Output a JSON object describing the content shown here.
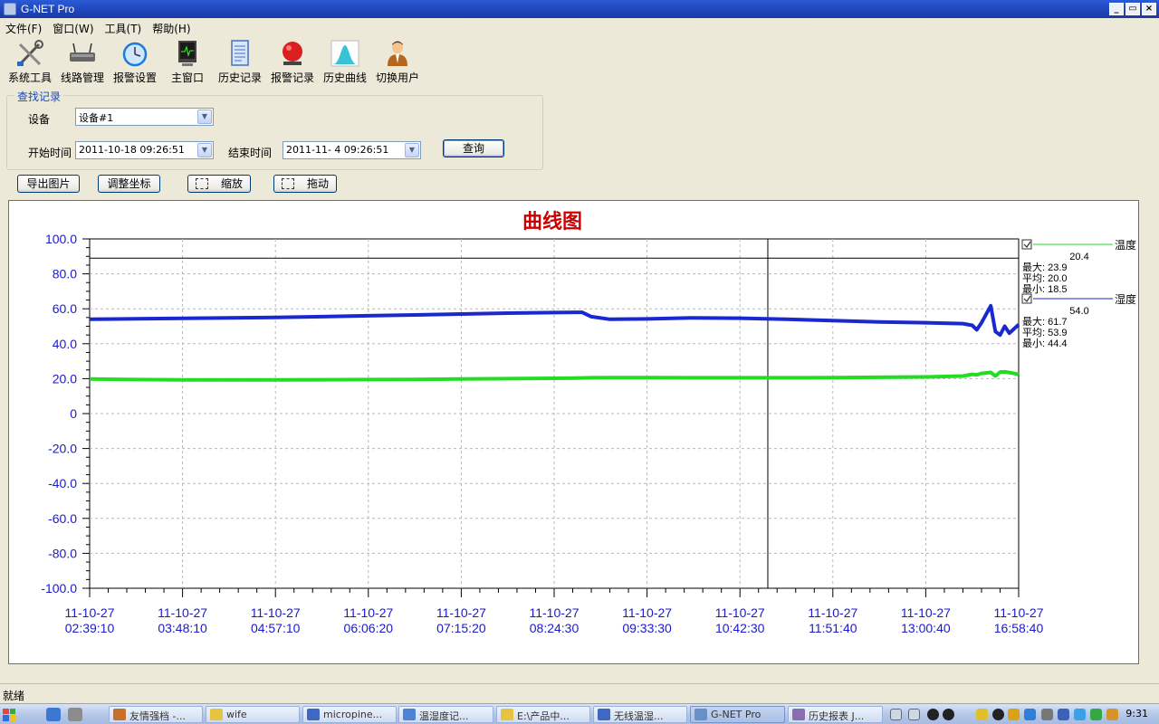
{
  "window": {
    "title": "G-NET Pro",
    "buttons": [
      "_",
      "▭",
      "×"
    ]
  },
  "menu": [
    "文件(F)",
    "窗口(W)",
    "工具(T)",
    "帮助(H)"
  ],
  "toolbar": [
    {
      "label": "系统工具",
      "icon": "tools-icon"
    },
    {
      "label": "线路管理",
      "icon": "router-icon"
    },
    {
      "label": "报警设置",
      "icon": "alarm-clock-icon"
    },
    {
      "label": "主窗口",
      "icon": "monitor-icon"
    },
    {
      "label": "历史记录",
      "icon": "document-icon"
    },
    {
      "label": "报警记录",
      "icon": "alarm-bell-icon"
    },
    {
      "label": "历史曲线",
      "icon": "curve-icon"
    },
    {
      "label": "切换用户",
      "icon": "user-icon"
    }
  ],
  "query": {
    "group_title": "查找记录",
    "device_label": "设备",
    "device_value": "设备#1",
    "start_label": "开始时间",
    "start_value": "2011-10-18 09:26:51",
    "end_label": "结束时间",
    "end_value": "2011-11-  4 09:26:51",
    "search_button": "查询"
  },
  "actions": {
    "export_image": "导出图片",
    "adjust_axis": "调整坐标",
    "zoom": "缩放",
    "drag": "拖动"
  },
  "status": "就绪",
  "taskbar": {
    "items": [
      "友情强档 -...",
      "wife",
      "micropine...",
      "温湿度记...",
      "E:\\产品中...",
      "无线温湿...",
      "G-NET Pro",
      "历史报表 J..."
    ],
    "active": "G-NET Pro",
    "clock": "9:31"
  },
  "colors": {
    "temperature": "#22dd22",
    "humidity": "#1a28d0",
    "title": "#cc0000",
    "axis_text": "#1a1acc"
  },
  "chart_data": {
    "type": "line",
    "title": "曲线图",
    "ylim": [
      -100,
      100
    ],
    "yticks": [
      100,
      80,
      60,
      40,
      20,
      0,
      -20,
      -40,
      -60,
      -80,
      -100
    ],
    "ytick_labels": [
      "100.0",
      "80.0",
      "60.0",
      "40.0",
      "20.0",
      "0",
      "-20.0",
      "-40.0",
      "-60.0",
      "-80.0",
      "-100.0"
    ],
    "xtick_labels": [
      [
        "11-10-27",
        "02:39:10"
      ],
      [
        "11-10-27",
        "03:48:10"
      ],
      [
        "11-10-27",
        "04:57:10"
      ],
      [
        "11-10-27",
        "06:06:20"
      ],
      [
        "11-10-27",
        "07:15:20"
      ],
      [
        "11-10-27",
        "08:24:30"
      ],
      [
        "11-10-27",
        "09:33:30"
      ],
      [
        "11-10-27",
        "10:42:30"
      ],
      [
        "11-10-27",
        "11:51:40"
      ],
      [
        "11-10-27",
        "13:00:40"
      ],
      [
        "11-10-27",
        "16:58:40"
      ]
    ],
    "x": [
      0,
      0.5,
      1,
      1.5,
      2,
      2.5,
      3,
      3.5,
      4,
      4.5,
      5,
      5.3,
      5.4,
      5.6,
      6,
      6.5,
      7,
      7.5,
      8,
      8.5,
      9,
      9.4,
      9.5,
      9.55,
      9.6,
      9.7,
      9.75,
      9.8,
      9.85,
      9.9,
      10
    ],
    "series": [
      {
        "name": "温度",
        "current": "20.4",
        "max": "23.9",
        "avg": "20.0",
        "min": "18.5",
        "values": [
          19.8,
          19.5,
          19.3,
          19.3,
          19.3,
          19.4,
          19.5,
          19.6,
          19.8,
          20.0,
          20.2,
          20.4,
          20.5,
          20.6,
          20.6,
          20.5,
          20.5,
          20.5,
          20.6,
          20.8,
          21.0,
          21.5,
          22.5,
          22.2,
          23.0,
          23.6,
          21.5,
          23.8,
          23.9,
          23.5,
          22.5
        ]
      },
      {
        "name": "湿度",
        "current": "54.0",
        "max": "61.7",
        "avg": "53.9",
        "min": "44.4",
        "values": [
          54.0,
          54.3,
          54.5,
          54.8,
          55.0,
          55.5,
          56.0,
          56.5,
          57.0,
          57.5,
          57.8,
          58.0,
          55.5,
          54.0,
          54.2,
          54.8,
          54.6,
          54.0,
          53.2,
          52.5,
          52.0,
          51.5,
          50.5,
          48.0,
          52.0,
          61.7,
          47.0,
          45.0,
          50.0,
          46.0,
          51.0
        ]
      }
    ],
    "cursor_x": 7.3,
    "hline": 89,
    "grid": true,
    "legend_position": "right",
    "legend_labels": {
      "max": "最大:",
      "avg": "平均:",
      "min": "最小:"
    }
  }
}
